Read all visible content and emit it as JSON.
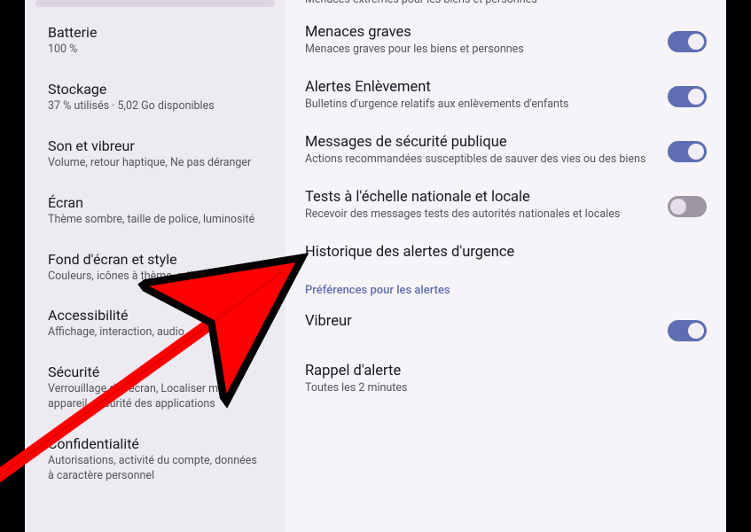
{
  "sidebar": {
    "items": [
      {
        "title": "",
        "sub": ""
      },
      {
        "title": "Batterie",
        "sub": "100 %"
      },
      {
        "title": "Stockage",
        "sub": "37 % utilisés · 5,02 Go disponibles"
      },
      {
        "title": "Son et vibreur",
        "sub": "Volume, retour haptique, Ne pas déranger"
      },
      {
        "title": "Écran",
        "sub": "Thème sombre, taille de police, luminosité"
      },
      {
        "title": "Fond d'écran et style",
        "sub": "Couleurs, icônes à thème, grille d'applis"
      },
      {
        "title": "Accessibilité",
        "sub": "Affichage, interaction, audio"
      },
      {
        "title": "Sécurité",
        "sub": "Verrouillage de l'écran, Localiser mon appareil, sécurité des applications"
      },
      {
        "title": "Confidentialité",
        "sub": "Autorisations, activité du compte, données à caractère personnel"
      }
    ]
  },
  "main": {
    "truncatedTop": "Menaces extrêmes pour les biens et personnes",
    "settings": [
      {
        "title": "Menaces graves",
        "sub": "Menaces graves pour les biens et personnes",
        "toggle": "on"
      },
      {
        "title": "Alertes Enlèvement",
        "sub": "Bulletins d'urgence relatifs aux enlèvements d'enfants",
        "toggle": "on"
      },
      {
        "title": "Messages de sécurité publique",
        "sub": "Actions recommandées susceptibles de sauver des vies ou des biens",
        "toggle": "on"
      },
      {
        "title": "Tests à l'échelle nationale et locale",
        "sub": "Recevoir des messages tests des autorités nationales et locales",
        "toggle": "off"
      },
      {
        "title": "Historique des alertes d'urgence",
        "sub": "",
        "toggle": null
      }
    ],
    "sectionHeader": "Préférences pour les alertes",
    "settings2": [
      {
        "title": "Vibreur",
        "sub": "",
        "toggle": "on"
      },
      {
        "title": "Rappel d'alerte",
        "sub": "Toutes les 2 minutes",
        "toggle": null
      }
    ]
  }
}
